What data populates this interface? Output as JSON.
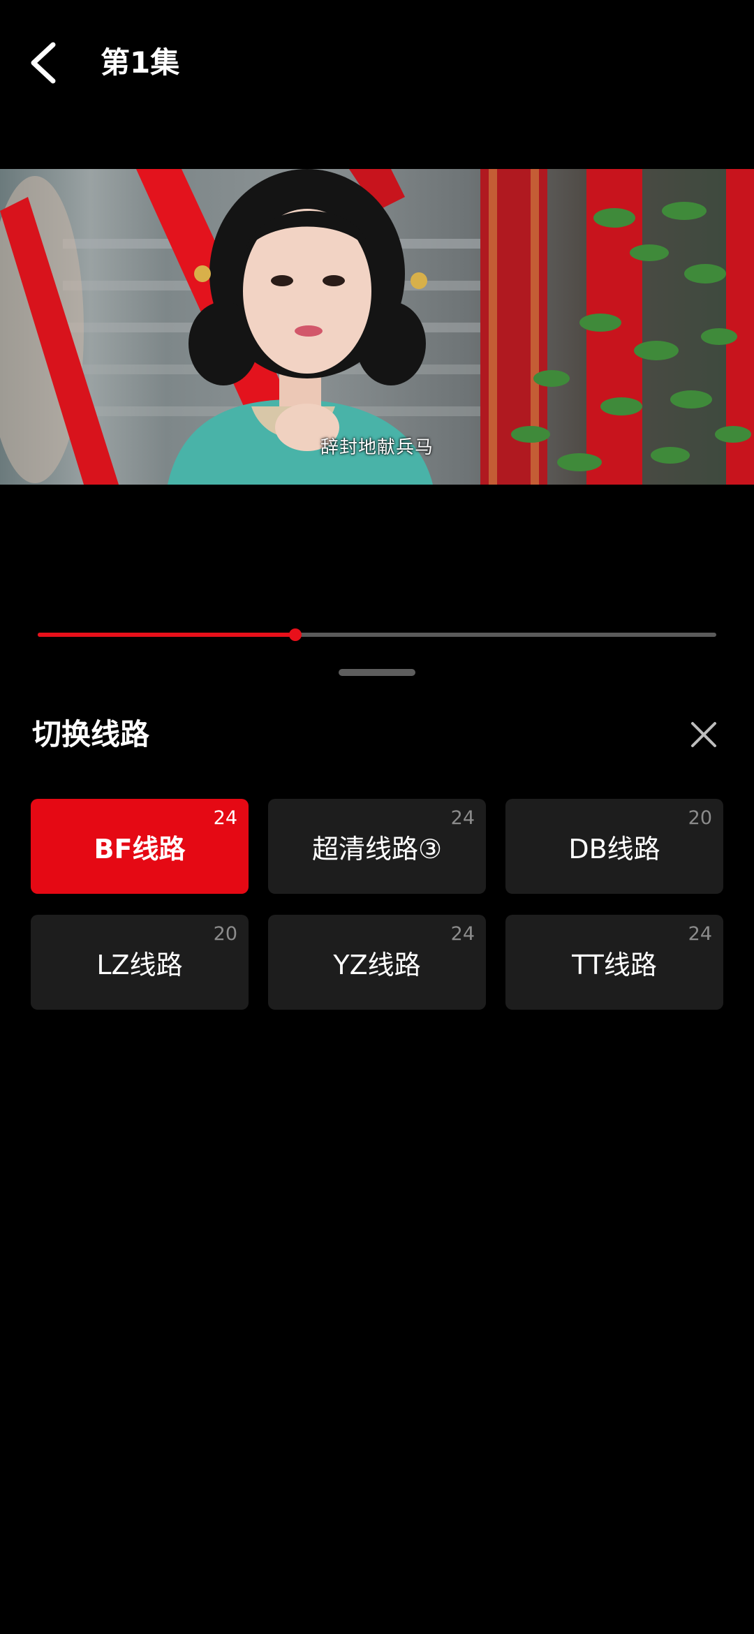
{
  "header": {
    "title": "第1集",
    "back_icon": "chevron-left-icon"
  },
  "video": {
    "subtitle": "辞封地献兵马"
  },
  "progress": {
    "value_percent": 38,
    "fill_color": "#e8101a"
  },
  "sheet": {
    "title": "切换线路",
    "close_icon": "close-icon",
    "lines": [
      {
        "name": "BF线路",
        "count": "24",
        "active": true
      },
      {
        "name": "超清线路③",
        "count": "24",
        "active": false
      },
      {
        "name": "DB线路",
        "count": "20",
        "active": false
      },
      {
        "name": "LZ线路",
        "count": "20",
        "active": false
      },
      {
        "name": "YZ线路",
        "count": "24",
        "active": false
      },
      {
        "name": "TT线路",
        "count": "24",
        "active": false
      }
    ]
  },
  "colors": {
    "accent": "#e50914",
    "background": "#000000",
    "tile": "#1d1d1d"
  }
}
